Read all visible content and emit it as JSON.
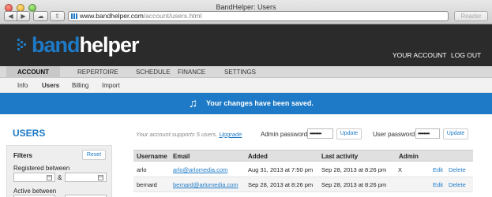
{
  "browser": {
    "window_title": "BandHelper: Users",
    "url_host": "www.bandhelper.com",
    "url_path": "/account/users.html",
    "reader_label": "Reader",
    "back_glyph": "◀",
    "forward_glyph": "▶",
    "cloud_glyph": "☁",
    "share_glyph": "⇪"
  },
  "header": {
    "logo_band": "band",
    "logo_helper": "helper",
    "your_account": "YOUR ACCOUNT",
    "logout": "LOG OUT"
  },
  "main_nav": {
    "items": [
      {
        "label": "ACCOUNT",
        "active": true
      },
      {
        "label": "REPERTOIRE",
        "active": false
      },
      {
        "label": "SCHEDULE",
        "active": false
      },
      {
        "label": "FINANCE",
        "active": false
      },
      {
        "label": "SETTINGS",
        "active": false
      }
    ]
  },
  "sub_nav": {
    "items": [
      {
        "label": "Info",
        "active": false
      },
      {
        "label": "Users",
        "active": true
      },
      {
        "label": "Billing",
        "active": false
      },
      {
        "label": "Import",
        "active": false
      }
    ]
  },
  "banner": {
    "icon": "♫",
    "message": "Your changes have been saved.",
    "color": "#1e7ac6"
  },
  "sidebar": {
    "title": "USERS",
    "filters_label": "Filters",
    "reset_label": "Reset",
    "registered_between_label": "Registered between",
    "amp": "&",
    "active_between_label": "Active between"
  },
  "content": {
    "supports_text": "Your account supports 5 users.",
    "upgrade_link": "Upgrade",
    "admin_password_label": "Admin password:",
    "admin_password_value": "••••••••",
    "user_password_label": "User password:",
    "user_password_value": "••••••••",
    "update_label": "Update"
  },
  "users_table": {
    "columns": [
      "Username",
      "Email",
      "Added",
      "Last activity",
      "Admin"
    ],
    "rows": [
      {
        "username": "arlo",
        "email": "arlo@arlomedia.com",
        "added": "Aug 31, 2013 at 7:50 pm",
        "last_activity": "Sep 28, 2013 at 8:26 pm",
        "admin": "X",
        "edit": "Edit",
        "delete": "Delete"
      },
      {
        "username": "bernard",
        "email": "bernard@arlomedia.com",
        "added": "Sep 28, 2013 at 8:26 pm",
        "last_activity": "Sep 28, 2013 at 8:26 pm",
        "admin": "",
        "edit": "Edit",
        "delete": "Delete"
      }
    ]
  }
}
